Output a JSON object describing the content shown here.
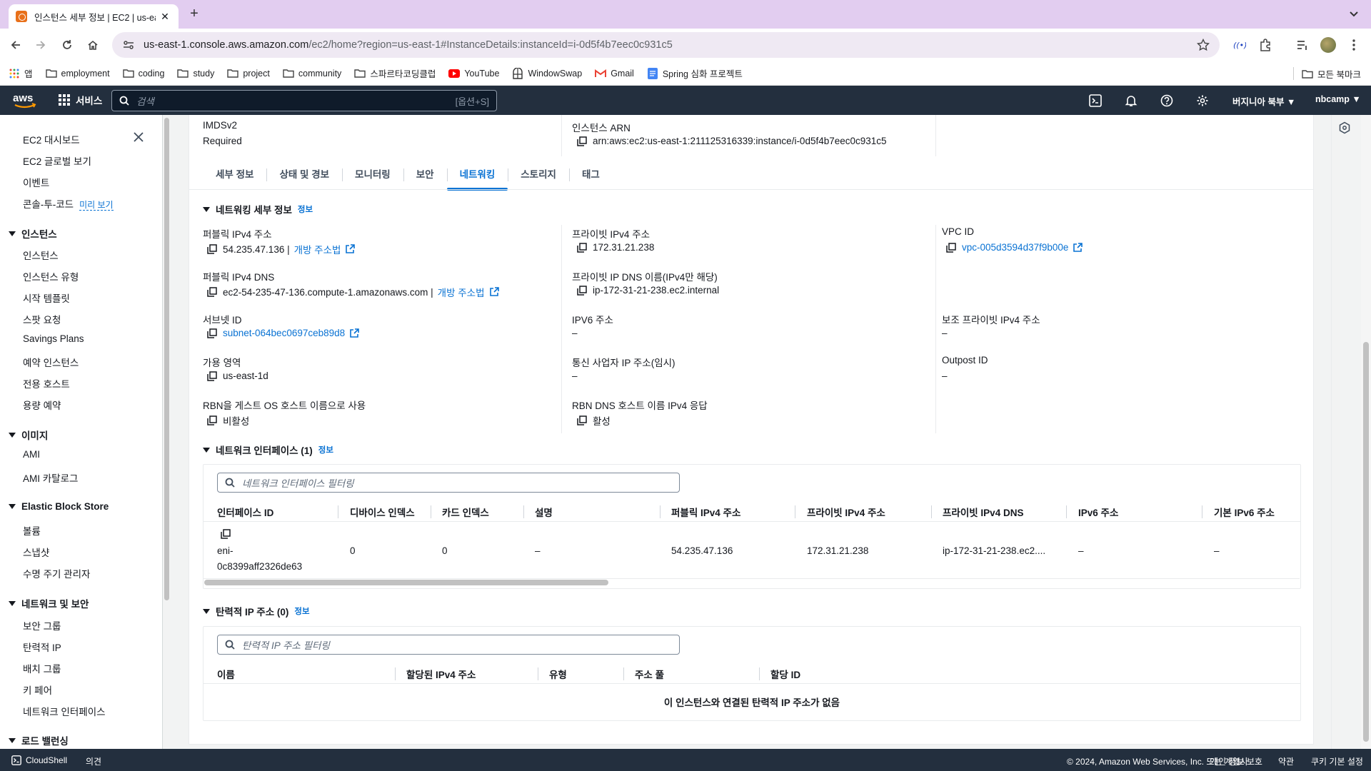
{
  "browser": {
    "tab_title": "인스턴스 세부 정보 | EC2 | us-ea",
    "url_host": "us-east-1.console.aws.amazon.com",
    "url_path": "/ec2/home?region=us-east-1#InstanceDetails:instanceId=i-0d5f4b7eec0c931c5",
    "bookmarks": [
      "앱",
      "employment",
      "coding",
      "study",
      "project",
      "community",
      "스파르타코딩클럽",
      "YouTube",
      "WindowSwap",
      "Gmail",
      "Spring 심화 프로젝트"
    ],
    "all_bookmarks": "모든 북마크"
  },
  "aws_nav": {
    "services": "서비스",
    "search_placeholder": "검색",
    "search_shortcut": "[옵션+S]",
    "region": "버지니아 북부 ▼",
    "account": "nbcamp ▼"
  },
  "sidebar": {
    "top_items": [
      "EC2 대시보드",
      "EC2 글로벌 보기",
      "이벤트",
      "콘솔-투-코드"
    ],
    "preview_label": "미리 보기",
    "groups": [
      {
        "title": "인스턴스",
        "items": [
          "인스턴스",
          "인스턴스 유형",
          "시작 템플릿",
          "스팟 요청",
          "Savings Plans",
          "예약 인스턴스",
          "전용 호스트",
          "용량 예약"
        ]
      },
      {
        "title": "이미지",
        "items": [
          "AMI",
          "AMI 카탈로그"
        ]
      },
      {
        "title": "Elastic Block Store",
        "items": [
          "볼륨",
          "스냅샷",
          "수명 주기 관리자"
        ]
      },
      {
        "title": "네트워크 및 보안",
        "items": [
          "보안 그룹",
          "탄력적 IP",
          "배치 그룹",
          "키 페어",
          "네트워크 인터페이스"
        ]
      },
      {
        "title": "로드 밸런싱",
        "items": []
      }
    ]
  },
  "top_fields": {
    "imds_label": "IMDSv2",
    "imds_value": "Required",
    "arn_label": "인스턴스 ARN",
    "arn_value": "arn:aws:ec2:us-east-1:211125316339:instance/i-0d5f4b7eec0c931c5"
  },
  "tabs": [
    "세부 정보",
    "상태 및 경보",
    "모니터링",
    "보안",
    "네트워킹",
    "스토리지",
    "태그"
  ],
  "networking": {
    "section_title": "네트워킹 세부 정보",
    "info": "정보",
    "public_ipv4_label": "퍼블릭 IPv4 주소",
    "public_ipv4_value": "54.235.47.136 |",
    "open_address_link": "개방 주소법",
    "private_ipv4_label": "프라이빗 IPv4 주소",
    "private_ipv4_value": "172.31.21.238",
    "vpc_label": "VPC ID",
    "vpc_value": "vpc-005d3594d37f9b00e",
    "public_dns_label": "퍼블릭 IPv4 DNS",
    "public_dns_value": "ec2-54-235-47-136.compute-1.amazonaws.com |",
    "private_dns_label": "프라이빗 IP DNS 이름(IPv4만 해당)",
    "private_dns_value": "ip-172-31-21-238.ec2.internal",
    "subnet_label": "서브넷 ID",
    "subnet_value": "subnet-064bec0697ceb89d8",
    "ipv6_label": "IPV6 주소",
    "ipv6_value": "–",
    "secondary_ip_label": "보조 프라이빗 IPv4 주소",
    "secondary_ip_value": "–",
    "az_label": "가용 영역",
    "az_value": "us-east-1d",
    "carrier_label": "통신 사업자 IP 주소(임시)",
    "carrier_value": "–",
    "outpost_label": "Outpost ID",
    "outpost_value": "–",
    "rbn_label": "RBN을 게스트 OS 호스트 이름으로 사용",
    "rbn_value": "비활성",
    "rbn_dns_label": "RBN DNS 호스트 이름 IPv4 응답",
    "rbn_dns_value": "활성"
  },
  "interfaces": {
    "section_title": "네트워크 인터페이스 (1)",
    "info": "정보",
    "filter_placeholder": "네트워크 인터페이스 필터링",
    "columns": [
      "인터페이스 ID",
      "디바이스 인덱스",
      "카드 인덱스",
      "설명",
      "퍼블릭 IPv4 주소",
      "프라이빗 IPv4 주소",
      "프라이빗 IPv4 DNS",
      "IPv6 주소",
      "기본 IPv6 주소"
    ],
    "row": {
      "id_line1": "eni-",
      "id_line2": "0c8399aff2326de63",
      "device_index": "0",
      "card_index": "0",
      "description": "–",
      "public_ipv4": "54.235.47.136",
      "private_ipv4": "172.31.21.238",
      "private_dns": "ip-172-31-21-238.ec2....",
      "ipv6": "–",
      "primary_ipv6": "–"
    }
  },
  "elastic_ips": {
    "section_title": "탄력적 IP 주소 (0)",
    "info": "정보",
    "filter_placeholder": "탄력적 IP 주소 필터링",
    "columns": [
      "이름",
      "할당된 IPv4 주소",
      "유형",
      "주소 풀",
      "할당 ID"
    ],
    "empty": "이 인스턴스와 연결된 탄력적 IP 주소가 없음"
  },
  "footer": {
    "cloudshell": "CloudShell",
    "feedback": "의견",
    "copyright": "© 2024, Amazon Web Services, Inc. 또는 계열사.",
    "privacy": "개인 정보 보호",
    "terms": "약관",
    "cookies": "쿠키 기본 설정"
  }
}
